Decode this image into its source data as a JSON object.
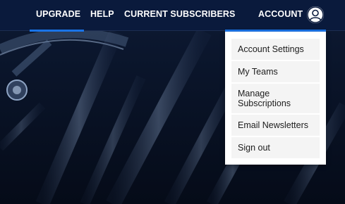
{
  "nav": {
    "upgrade": "UPGRADE",
    "help": "HELP",
    "current_subscribers": "CURRENT SUBSCRIBERS",
    "account": "ACCOUNT"
  },
  "account_menu": {
    "items": [
      "Account Settings",
      "My Teams",
      "Manage Subscriptions",
      "Email Newsletters",
      "Sign out"
    ]
  },
  "icons": {
    "avatar": "user-avatar-icon"
  },
  "colors": {
    "nav_background": "#0a1a3c",
    "accent": "#1a74e8",
    "menu_background": "#ffffff",
    "menu_item_background": "#f4f4f4"
  }
}
